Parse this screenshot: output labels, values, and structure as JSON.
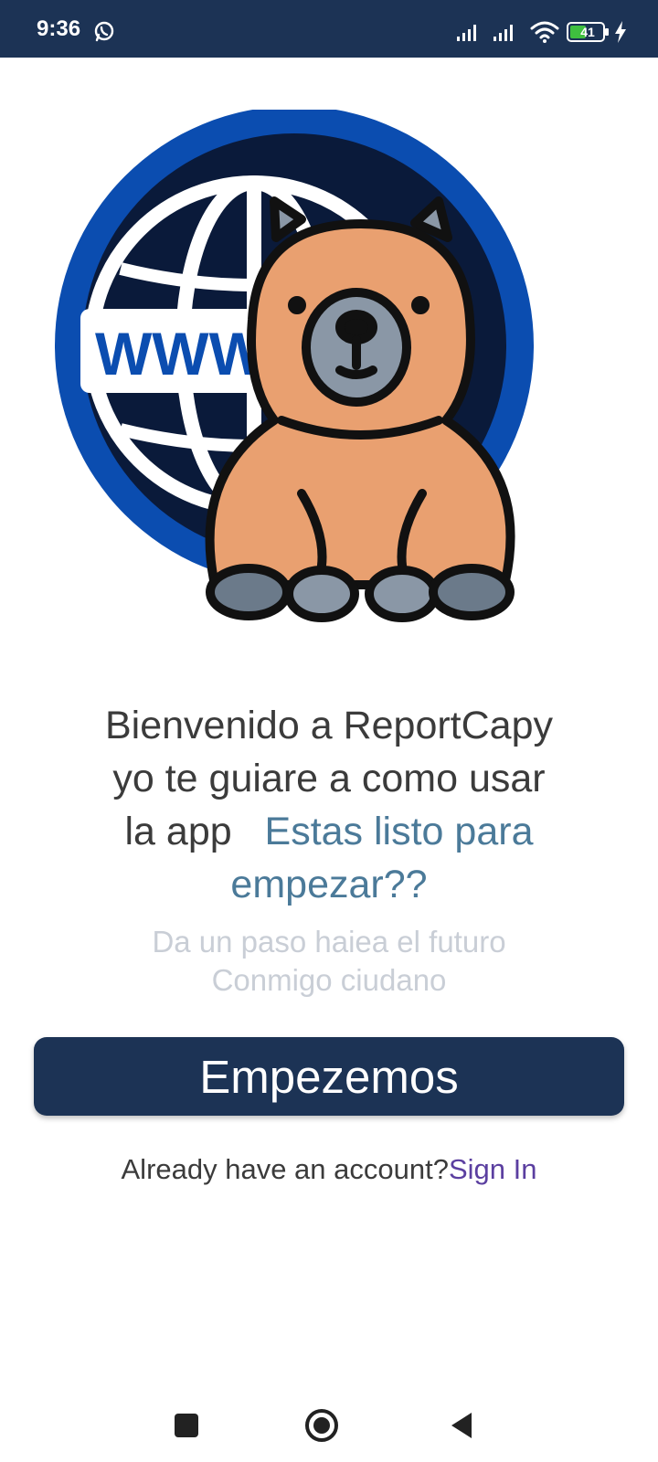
{
  "status_bar": {
    "time": "9:36",
    "battery_level": "41",
    "icons": [
      "whatsapp-icon",
      "signal-icon",
      "signal-icon",
      "wifi-icon",
      "battery-icon",
      "charging-bolt-icon"
    ]
  },
  "hero": {
    "globe_label": "WWW",
    "description_icons": [
      "globe-icon",
      "capybara-mascot"
    ]
  },
  "welcome": {
    "line1": "Bienvenido a ReportCapy",
    "line2": "yo te guiare a como usar",
    "line3_plain": "la app",
    "line3_accent": "Estas listo para",
    "line4_accent": "empezar??"
  },
  "subtitle": {
    "line1": "Da un paso haiea el futuro",
    "line2": "Conmigo ciudano"
  },
  "primary_button": {
    "label": "Empezemos"
  },
  "signin": {
    "prompt": "Already have an account?",
    "link": "Sign In"
  },
  "colors": {
    "navy": "#1c3355",
    "accent_text": "#4b7a99",
    "link": "#5b3fa0",
    "muted": "#c9ced6",
    "globe_blue": "#0b4db0",
    "capybara": "#e9a070"
  }
}
